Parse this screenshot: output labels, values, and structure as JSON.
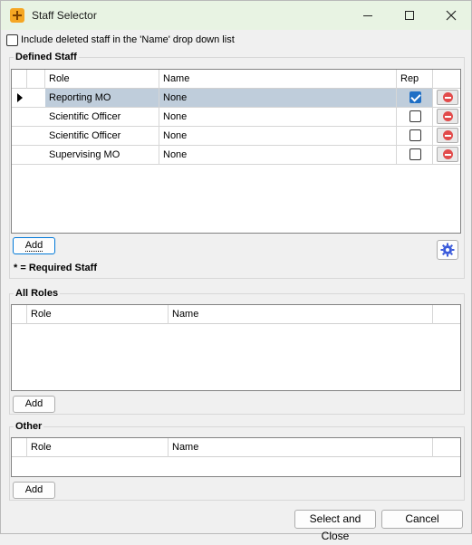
{
  "window": {
    "title": "Staff Selector"
  },
  "include_deleted": {
    "label": "Include deleted staff in the 'Name' drop down list",
    "checked": false
  },
  "defined_staff": {
    "title": "Defined Staff",
    "columns": [
      "Role",
      "Name",
      "Rep"
    ],
    "rows": [
      {
        "role": "Reporting MO",
        "name": "None",
        "rep": true,
        "selected": true
      },
      {
        "role": "Scientific Officer",
        "name": "None",
        "rep": false,
        "selected": false
      },
      {
        "role": "Scientific Officer",
        "name": "None",
        "rep": false,
        "selected": false
      },
      {
        "role": "Supervising MO",
        "name": "None",
        "rep": false,
        "selected": false
      }
    ],
    "add_label": "Add",
    "required_note": "* = Required Staff"
  },
  "all_roles": {
    "title": "All Roles",
    "columns": [
      "Role",
      "Name"
    ],
    "add_label": "Add"
  },
  "other": {
    "title": "Other",
    "columns": [
      "Role",
      "Name"
    ],
    "add_label": "Add"
  },
  "footer": {
    "select_close_label": "Select and Close",
    "cancel_label": "Cancel"
  },
  "colors": {
    "selected_row": "#bfcddb",
    "titlebar": "#e8f3e3",
    "checkbox_checked": "#1f6fc5",
    "remove_icon": "#e24b4b"
  },
  "icons": {
    "app": "orange-plus-icon",
    "remove": "minus-circle-icon",
    "settings": "gear-icon"
  }
}
